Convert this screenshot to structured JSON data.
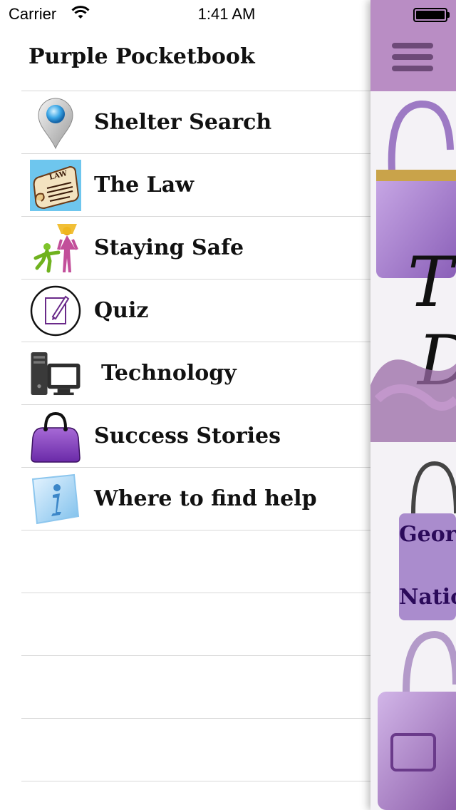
{
  "status_bar": {
    "carrier": "Carrier",
    "time": "1:41 AM"
  },
  "menu": {
    "title": "Purple Pocketbook",
    "items": [
      {
        "label": "Shelter Search",
        "icon": "map-pin-icon"
      },
      {
        "label": "The Law",
        "icon": "law-scroll-icon"
      },
      {
        "label": "Staying Safe",
        "icon": "family-icon"
      },
      {
        "label": "Quiz",
        "icon": "quiz-pencil-icon"
      },
      {
        "label": "Technology",
        "icon": "computer-icon"
      },
      {
        "label": "Success Stories",
        "icon": "purple-handbag-icon"
      },
      {
        "label": "Where to find help",
        "icon": "info-icon"
      }
    ]
  },
  "panel": {
    "text_1": "Georg",
    "text_2": "Natio",
    "header_color": "#b98dc4"
  },
  "colors": {
    "accent": "#b98dc4",
    "bag_purple": "#8a4fc0",
    "text_purple": "#2b0a5a"
  }
}
